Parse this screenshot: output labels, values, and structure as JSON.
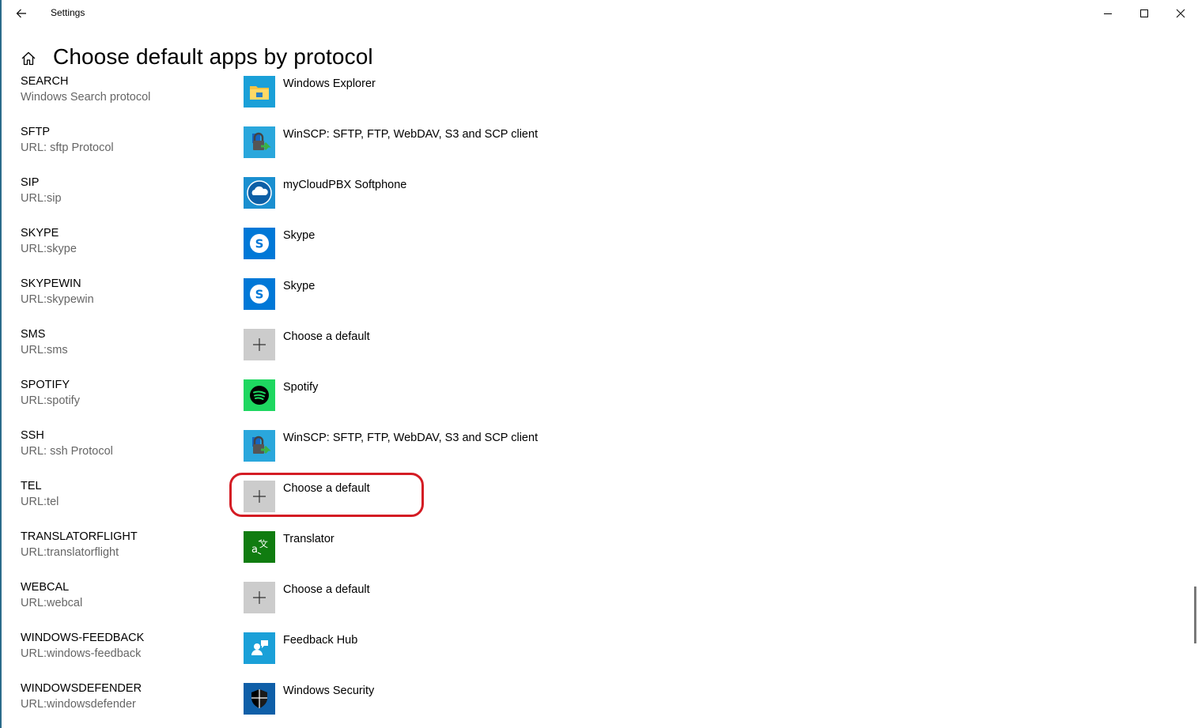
{
  "window": {
    "title": "Settings"
  },
  "header": {
    "title": "Choose default apps by protocol"
  },
  "rows": [
    {
      "name": "SEARCH",
      "desc": "Windows Search protocol",
      "app": "Windows Explorer",
      "icon": "folder-icon"
    },
    {
      "name": "SFTP",
      "desc": "URL: sftp Protocol",
      "app": "WinSCP: SFTP, FTP, WebDAV, S3 and SCP client",
      "icon": "winscp-icon"
    },
    {
      "name": "SIP",
      "desc": "URL:sip",
      "app": "myCloudPBX Softphone",
      "icon": "mycloudpbx-icon"
    },
    {
      "name": "SKYPE",
      "desc": "URL:skype",
      "app": "Skype",
      "icon": "skype-icon"
    },
    {
      "name": "SKYPEWIN",
      "desc": "URL:skypewin",
      "app": "Skype",
      "icon": "skype-icon"
    },
    {
      "name": "SMS",
      "desc": "URL:sms",
      "app": "Choose a default",
      "icon": "plus-icon"
    },
    {
      "name": "SPOTIFY",
      "desc": "URL:spotify",
      "app": "Spotify",
      "icon": "spotify-icon"
    },
    {
      "name": "SSH",
      "desc": "URL: ssh Protocol",
      "app": "WinSCP: SFTP, FTP, WebDAV, S3 and SCP client",
      "icon": "winscp-icon"
    },
    {
      "name": "TEL",
      "desc": "URL:tel",
      "app": "Choose a default",
      "icon": "plus-icon"
    },
    {
      "name": "TRANSLATORFLIGHT",
      "desc": "URL:translatorflight",
      "app": "Translator",
      "icon": "translator-icon"
    },
    {
      "name": "WEBCAL",
      "desc": "URL:webcal",
      "app": "Choose a default",
      "icon": "plus-icon"
    },
    {
      "name": "WINDOWS-FEEDBACK",
      "desc": "URL:windows-feedback",
      "app": "Feedback Hub",
      "icon": "feedback-hub-icon"
    },
    {
      "name": "WINDOWSDEFENDER",
      "desc": "URL:windowsdefender",
      "app": "Windows Security",
      "icon": "shield-icon"
    }
  ],
  "colors": {
    "highlight": "#d41c24",
    "secondary_text": "#666666",
    "placeholder_icon_bg": "#cccccc"
  }
}
